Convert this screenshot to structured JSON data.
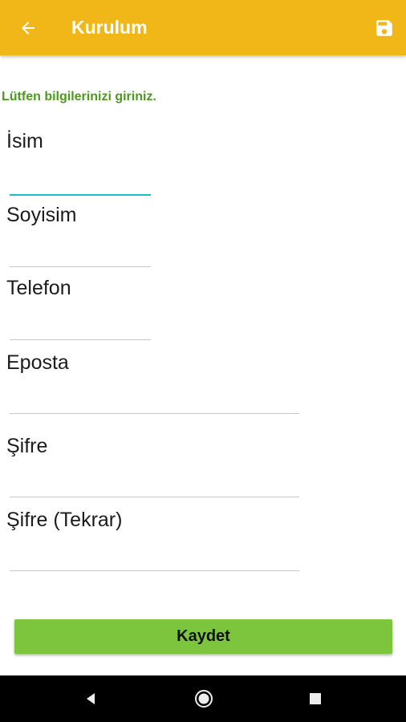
{
  "app_bar": {
    "title": "Kurulum",
    "back_icon": "arrow-left-icon",
    "save_icon": "floppy-disk-icon",
    "color": "#f1b718"
  },
  "form": {
    "instructions": "Lütfen bilgilerinizi giriniz.",
    "fields": [
      {
        "label": "İsim",
        "value": "",
        "focused": true
      },
      {
        "label": "Soyisim",
        "value": ""
      },
      {
        "label": "Telefon",
        "value": ""
      },
      {
        "label": "Eposta",
        "value": ""
      },
      {
        "label": "Şifre",
        "value": ""
      },
      {
        "label": "Şifre (Tekrar)",
        "value": ""
      }
    ],
    "accent_color": "#15c2c6"
  },
  "actions": {
    "save_label": "Kaydet",
    "button_color": "#7dc53d"
  },
  "system_nav": {
    "back_icon": "triangle-back-icon",
    "home_icon": "circle-home-icon",
    "recents_icon": "square-recents-icon"
  }
}
